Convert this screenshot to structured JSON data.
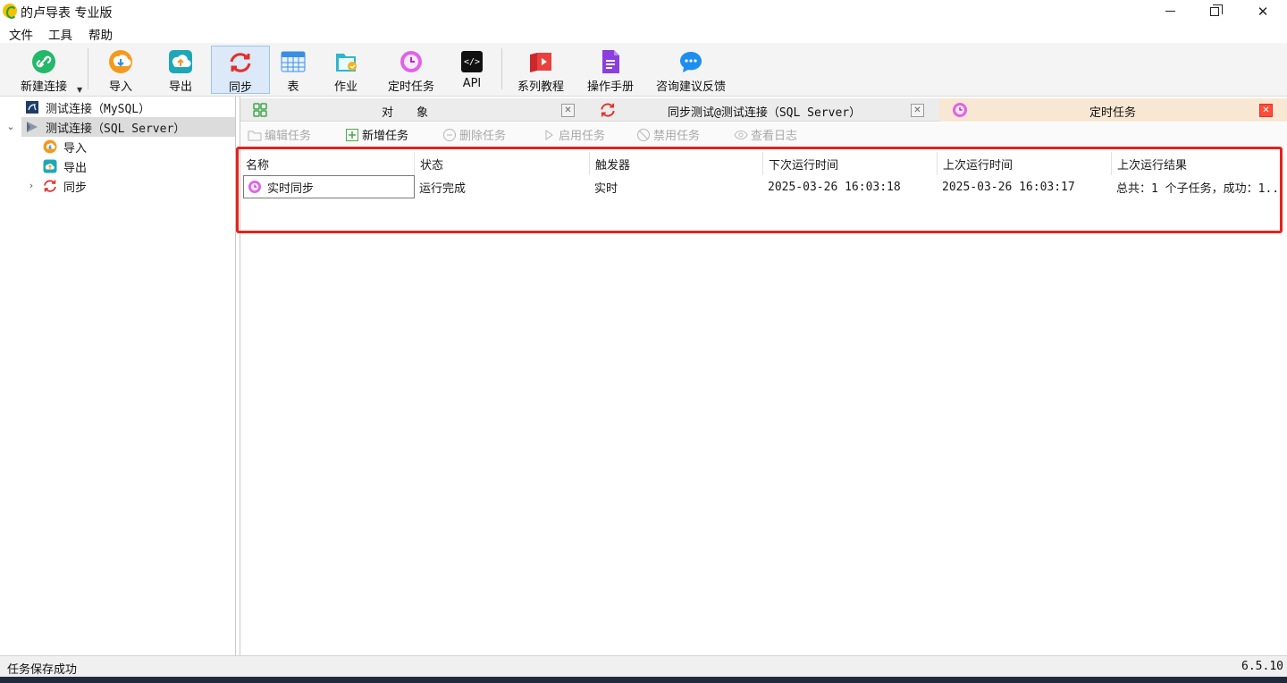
{
  "window": {
    "title": "的卢导表 专业版"
  },
  "menu": [
    "文件",
    "工具",
    "帮助"
  ],
  "toolbar": {
    "new_connection": "新建连接",
    "import": "导入",
    "export": "导出",
    "sync": "同步",
    "table": "表",
    "job": "作业",
    "scheduled_task": "定时任务",
    "api": "API",
    "tutorials": "系列教程",
    "manual": "操作手册",
    "feedback": "咨询建议反馈",
    "api_icon_text": "</>"
  },
  "tree": {
    "conn_mysql": "测试连接（MySQL）",
    "conn_sqlserver": "测试连接（SQL Server）",
    "import": "导入",
    "export": "导出",
    "sync": "同步"
  },
  "tabs": {
    "objects": "对　　象",
    "sync_tab": "同步测试@测试连接（SQL Server）",
    "scheduled": "定时任务"
  },
  "actions": {
    "edit": "编辑任务",
    "add": "新增任务",
    "delete": "删除任务",
    "enable": "启用任务",
    "disable": "禁用任务",
    "log": "查看日志"
  },
  "grid": {
    "headers": {
      "name": "名称",
      "status": "状态",
      "trigger": "触发器",
      "next_run": "下次运行时间",
      "last_run": "上次运行时间",
      "last_result": "上次运行结果"
    },
    "rows": [
      {
        "name": "实时同步",
        "status": "运行完成",
        "trigger": "实时",
        "next_run": "2025-03-26 16:03:18",
        "last_run": "2025-03-26 16:03:17",
        "last_result": "总共：1 个子任务，成功：1..."
      }
    ]
  },
  "status": {
    "message": "任务保存成功",
    "version": "6.5.10"
  }
}
